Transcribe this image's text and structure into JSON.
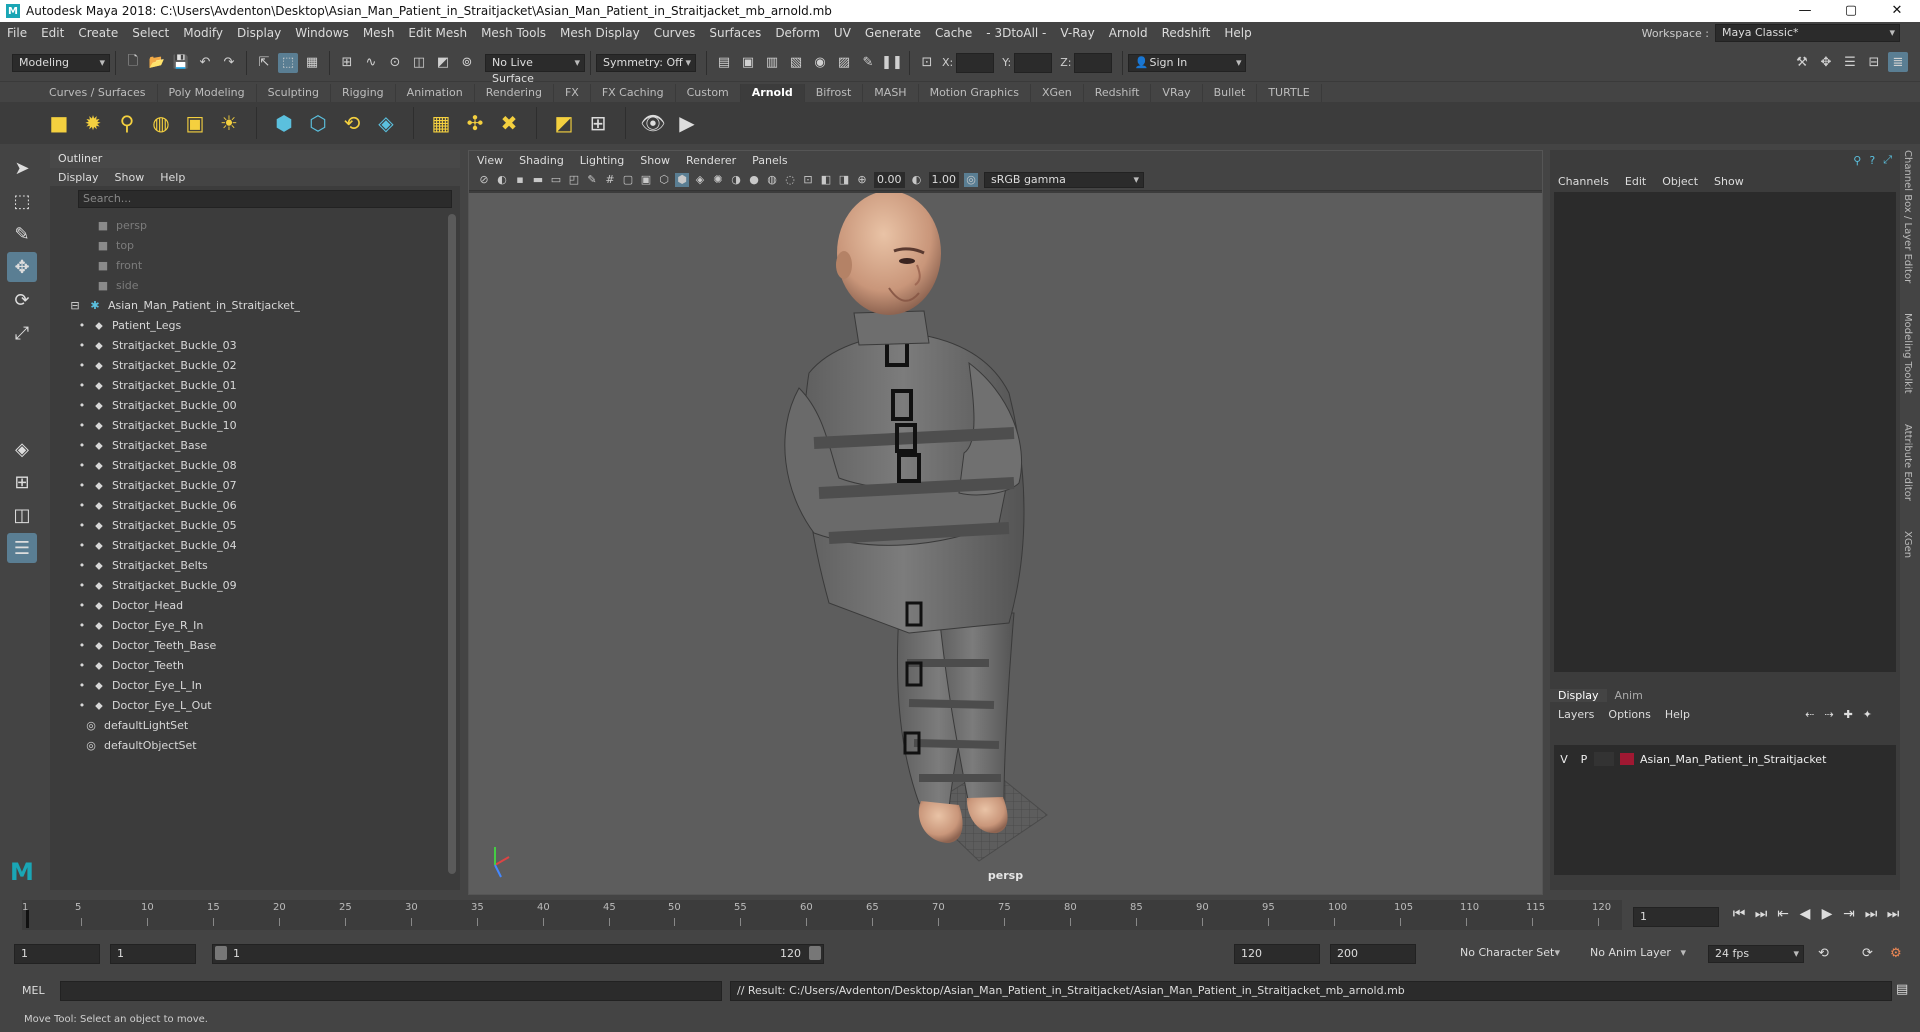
{
  "title": "Autodesk Maya 2018: C:\\Users\\Avdenton\\Desktop\\Asian_Man_Patient_in_Straitjacket\\Asian_Man_Patient_in_Straitjacket_mb_arnold.mb",
  "menu": [
    "File",
    "Edit",
    "Create",
    "Select",
    "Modify",
    "Display",
    "Windows",
    "Mesh",
    "Edit Mesh",
    "Mesh Tools",
    "Mesh Display",
    "Curves",
    "Surfaces",
    "Deform",
    "UV",
    "Generate",
    "Cache",
    "- 3DtoAll -",
    "V-Ray",
    "Arnold",
    "Redshift",
    "Help"
  ],
  "workspace": {
    "label": "Workspace :",
    "value": "Maya Classic*"
  },
  "status": {
    "mode": "Modeling",
    "live_surface": "No Live Surface",
    "symmetry": "Symmetry: Off",
    "x": "X:",
    "y": "Y:",
    "z": "Z:",
    "sign_in": "Sign In"
  },
  "shelf_tabs": [
    "Curves / Surfaces",
    "Poly Modeling",
    "Sculpting",
    "Rigging",
    "Animation",
    "Rendering",
    "FX",
    "FX Caching",
    "Custom",
    "Arnold",
    "Bifrost",
    "MASH",
    "Motion Graphics",
    "XGen",
    "Redshift",
    "VRay",
    "Bullet",
    "TURTLE"
  ],
  "active_shelf": "Arnold",
  "outliner": {
    "title": "Outliner",
    "menu": [
      "Display",
      "Show",
      "Help"
    ],
    "search_placeholder": "Search...",
    "items": [
      {
        "label": "persp",
        "kind": "camera"
      },
      {
        "label": "top",
        "kind": "camera"
      },
      {
        "label": "front",
        "kind": "camera"
      },
      {
        "label": "side",
        "kind": "camera"
      },
      {
        "label": "Asian_Man_Patient_in_Straitjacket_",
        "kind": "root"
      },
      {
        "label": "Patient_Legs",
        "kind": "mesh"
      },
      {
        "label": "Straitjacket_Buckle_03",
        "kind": "mesh"
      },
      {
        "label": "Straitjacket_Buckle_02",
        "kind": "mesh"
      },
      {
        "label": "Straitjacket_Buckle_01",
        "kind": "mesh"
      },
      {
        "label": "Straitjacket_Buckle_00",
        "kind": "mesh"
      },
      {
        "label": "Straitjacket_Buckle_10",
        "kind": "mesh"
      },
      {
        "label": "Straitjacket_Base",
        "kind": "mesh"
      },
      {
        "label": "Straitjacket_Buckle_08",
        "kind": "mesh"
      },
      {
        "label": "Straitjacket_Buckle_07",
        "kind": "mesh"
      },
      {
        "label": "Straitjacket_Buckle_06",
        "kind": "mesh"
      },
      {
        "label": "Straitjacket_Buckle_05",
        "kind": "mesh"
      },
      {
        "label": "Straitjacket_Buckle_04",
        "kind": "mesh"
      },
      {
        "label": "Straitjacket_Belts",
        "kind": "mesh"
      },
      {
        "label": "Straitjacket_Buckle_09",
        "kind": "mesh"
      },
      {
        "label": "Doctor_Head",
        "kind": "mesh"
      },
      {
        "label": "Doctor_Eye_R_In",
        "kind": "mesh"
      },
      {
        "label": "Doctor_Teeth_Base",
        "kind": "mesh"
      },
      {
        "label": "Doctor_Teeth",
        "kind": "mesh"
      },
      {
        "label": "Doctor_Eye_L_In",
        "kind": "mesh"
      },
      {
        "label": "Doctor_Eye_L_Out",
        "kind": "mesh"
      },
      {
        "label": "defaultLightSet",
        "kind": "set"
      },
      {
        "label": "defaultObjectSet",
        "kind": "set"
      }
    ]
  },
  "viewport": {
    "menu": [
      "View",
      "Shading",
      "Lighting",
      "Show",
      "Renderer",
      "Panels"
    ],
    "exposure": "0.00",
    "gamma": "1.00",
    "color_space": "sRGB gamma",
    "camera_label": "persp"
  },
  "channelbox": {
    "menu": [
      "Channels",
      "Edit",
      "Object",
      "Show"
    ]
  },
  "side_tabs": [
    "Channel Box / Layer Editor",
    "Modeling Toolkit",
    "Attribute Editor",
    "XGen"
  ],
  "layer_editor": {
    "tabs": [
      "Display",
      "Anim"
    ],
    "menu": [
      "Layers",
      "Options",
      "Help"
    ],
    "layer": {
      "v": "V",
      "p": "P",
      "name": "Asian_Man_Patient_in_Straitjacket",
      "color": "#a01832"
    }
  },
  "timeline": {
    "ticks": [
      "1",
      "5",
      "10",
      "15",
      "20",
      "25",
      "30",
      "35",
      "40",
      "45",
      "50",
      "55",
      "60",
      "65",
      "70",
      "75",
      "80",
      "85",
      "90",
      "95",
      "100",
      "105",
      "110",
      "115",
      "120"
    ],
    "current_frame": "1"
  },
  "range": {
    "start": "1",
    "inner_start": "1",
    "slider_start": "1",
    "slider_end": "120",
    "end": "120",
    "anim_end": "200",
    "character_set": "No Character Set",
    "anim_layer": "No Anim Layer",
    "fps": "24 fps"
  },
  "cmdline": {
    "lang": "MEL",
    "result": "// Result: C:/Users/Avdenton/Desktop/Asian_Man_Patient_in_Straitjacket/Asian_Man_Patient_in_Straitjacket_mb_arnold.mb"
  },
  "help": "Move Tool: Select an object to move."
}
